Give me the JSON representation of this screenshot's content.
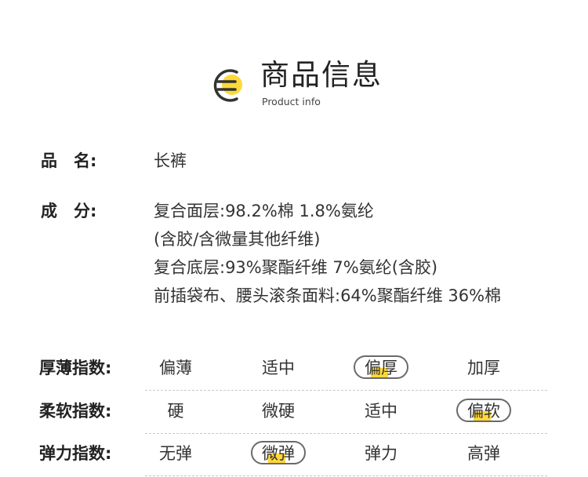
{
  "header": {
    "title": "商品信息",
    "subtitle": "Product info",
    "icon": "document-list-icon",
    "accent_color": "#ffd83a"
  },
  "product": {
    "name_label": "品　名:",
    "name_value": "长裤",
    "composition_label": "成　分:",
    "composition_lines": [
      "复合面层:98.2%棉 1.8%氨纶",
      "(含胶/含微量其他纤维)",
      "复合底层:93%聚酯纤维 7%氨纶(含胶)",
      "前插袋布、腰头滚条面料:64%聚酯纤维 36%棉"
    ]
  },
  "indices": [
    {
      "label": "厚薄指数:",
      "options": [
        "偏薄",
        "适中",
        "偏厚",
        "加厚"
      ],
      "selected": 2
    },
    {
      "label": "柔软指数:",
      "options": [
        "硬",
        "微硬",
        "适中",
        "偏软"
      ],
      "selected": 3
    },
    {
      "label": "弹力指数:",
      "options": [
        "无弹",
        "微弹",
        "弹力",
        "高弹"
      ],
      "selected": 1
    }
  ]
}
